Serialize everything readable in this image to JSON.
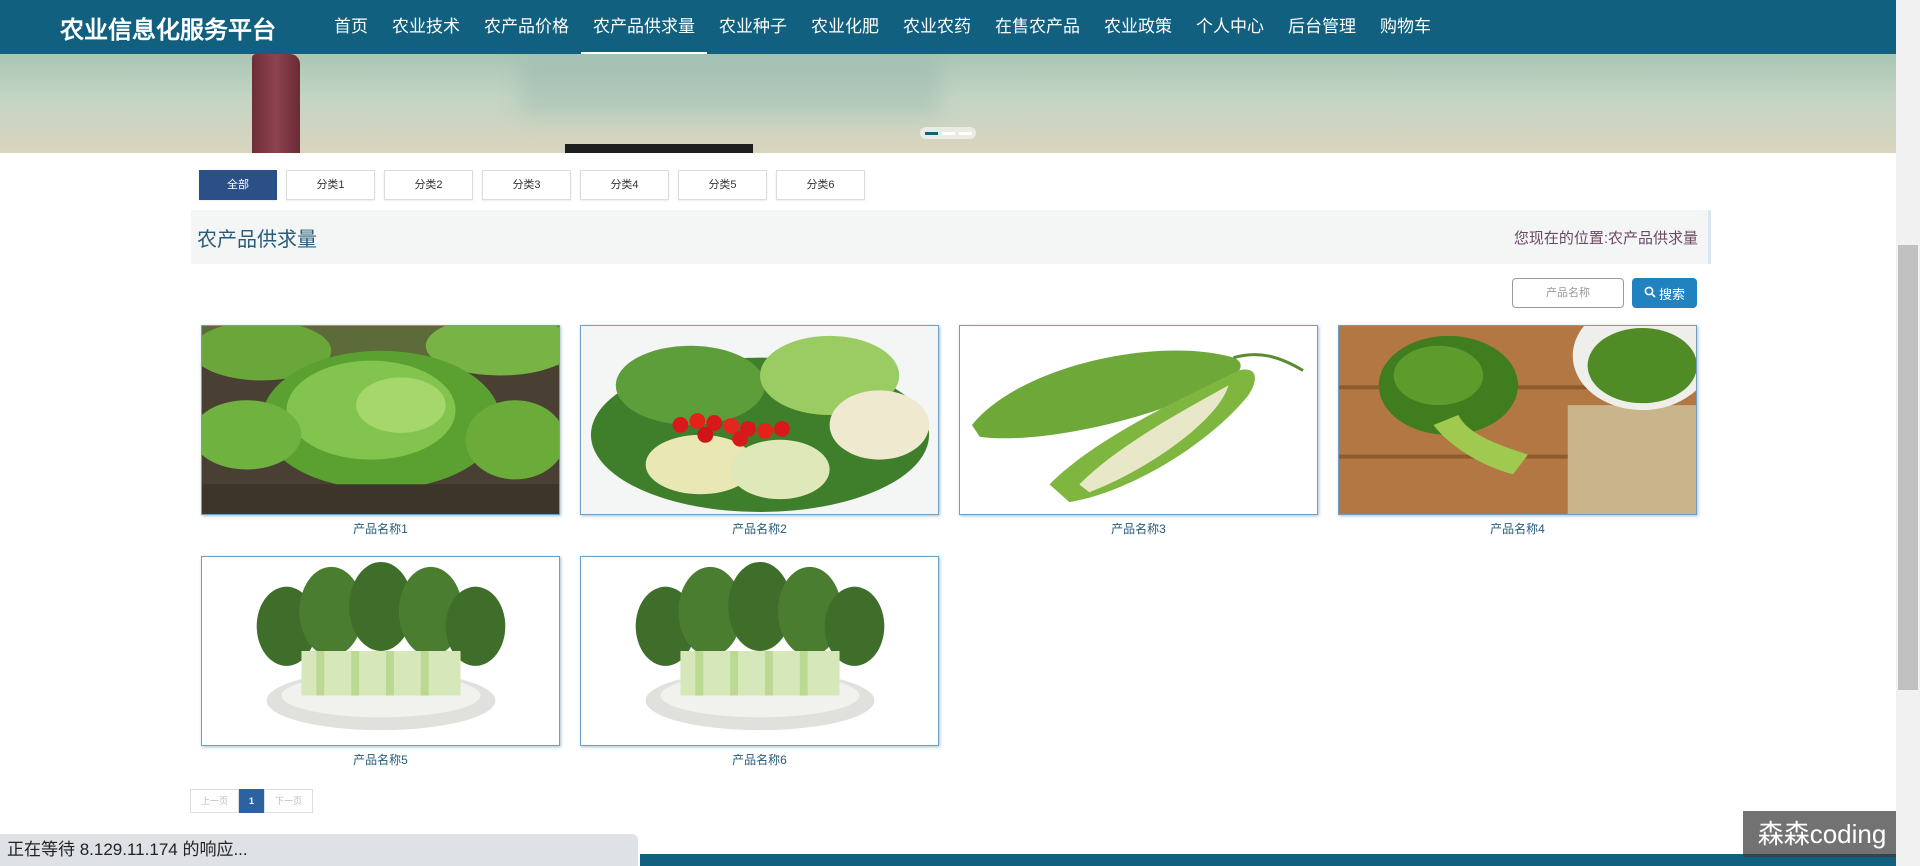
{
  "nav": {
    "brand": "农业信息化服务平台",
    "items": [
      {
        "label": "首页"
      },
      {
        "label": "农业技术"
      },
      {
        "label": "农产品价格"
      },
      {
        "label": "农产品供求量",
        "active": true
      },
      {
        "label": "农业种子"
      },
      {
        "label": "农业化肥"
      },
      {
        "label": "农业农药"
      },
      {
        "label": "在售农产品"
      },
      {
        "label": "农业政策"
      },
      {
        "label": "个人中心"
      },
      {
        "label": "后台管理"
      },
      {
        "label": "购物车"
      }
    ]
  },
  "banner": {
    "slide_count": 3,
    "active_slide": 1
  },
  "categories": [
    "全部",
    "分类1",
    "分类2",
    "分类3",
    "分类4",
    "分类5",
    "分类6"
  ],
  "page": {
    "title": "农产品供求量",
    "breadcrumb_prefix": "您现在的位置:",
    "breadcrumb_current": "农产品供求量"
  },
  "search": {
    "placeholder": "产品名称",
    "button_label": "搜索"
  },
  "products": [
    {
      "name": "产品名称1",
      "image": "lettuce-field"
    },
    {
      "name": "产品名称2",
      "image": "vegetable-platter"
    },
    {
      "name": "产品名称3",
      "image": "bitter-melon"
    },
    {
      "name": "产品名称4",
      "image": "broccoli"
    },
    {
      "name": "产品名称5",
      "image": "bok-choy-plate"
    },
    {
      "name": "产品名称6",
      "image": "bok-choy-plate"
    }
  ],
  "pagination": {
    "prev_label": "上一页",
    "current_page": "1",
    "next_label": "下一页"
  },
  "browser_status": "正在等待 8.129.11.174 的响应...",
  "watermark": "森森coding",
  "colors": {
    "nav": "#11607f",
    "active_tab": "#2b4f87",
    "search_button": "#2282c0"
  }
}
